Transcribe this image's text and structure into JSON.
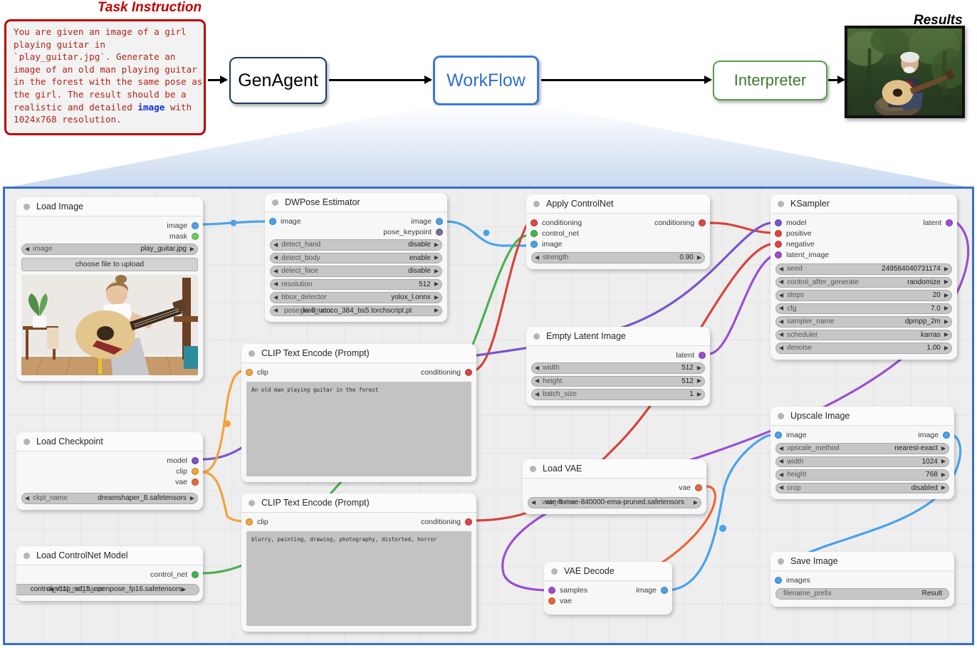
{
  "header": {
    "task_title": "Task Instruction",
    "results_title": "Results",
    "task_text_line1": "You are given an image of a girl playing guitar in `play_guitar.jpg`. Generate an image of an old man playing guitar in the forest with the same pose as the girl. The result should be a realistic and detailed ",
    "task_keyword": "image",
    "task_text_line2": " with 1024x768 resolution."
  },
  "pipeline": {
    "genagent": "GenAgent",
    "workflow": "WorkFlow",
    "interpreter": "Interpreter"
  },
  "nodes": [
    {
      "id": "load-image",
      "title": "Load Image",
      "inputs": [],
      "outputs": [
        {
          "name": "image",
          "color": "#4aa3e8"
        },
        {
          "name": "mask",
          "color": "#6dce5e"
        }
      ],
      "widgets": [
        {
          "label": "image",
          "value": "play_guitar.jpg",
          "arrows": true
        }
      ],
      "button": "choose file to upload",
      "preview": "girl-guitar"
    },
    {
      "id": "dwpose-estimator",
      "title": "DWPose Estimator",
      "inputs": [
        {
          "name": "image",
          "color": "#4aa3e8"
        }
      ],
      "outputs": [
        {
          "name": "image",
          "color": "#4aa3e8"
        },
        {
          "name": "pose_keypoint",
          "color": "#7a6f96"
        }
      ],
      "widgets": [
        {
          "label": "detect_hand",
          "value": "disable",
          "arrows": true
        },
        {
          "label": "detect_body",
          "value": "enable",
          "arrows": true
        },
        {
          "label": "detect_face",
          "value": "disable",
          "arrows": true
        },
        {
          "label": "resolution",
          "value": "512",
          "arrows": true
        },
        {
          "label": "bbox_detector",
          "value": "yolox_l.onnx",
          "arrows": true
        },
        {
          "label": "pose_estimator",
          "value": "dw-ll_ucoco_384_bs5.torchscript.pt",
          "arrows": true,
          "overlap": true
        }
      ]
    },
    {
      "id": "apply-controlnet",
      "title": "Apply ControlNet",
      "inputs": [
        {
          "name": "conditioning",
          "color": "#e04444"
        },
        {
          "name": "control_net",
          "color": "#44b44a"
        },
        {
          "name": "image",
          "color": "#4aa3e8"
        }
      ],
      "outputs": [
        {
          "name": "conditioning",
          "color": "#e04444"
        }
      ],
      "widgets": [
        {
          "label": "strength",
          "value": "0.90",
          "arrows": true
        }
      ]
    },
    {
      "id": "ksampler",
      "title": "KSampler",
      "inputs": [
        {
          "name": "model",
          "color": "#7a55c9"
        },
        {
          "name": "positive",
          "color": "#e04444"
        },
        {
          "name": "negative",
          "color": "#e04444"
        },
        {
          "name": "latent_image",
          "color": "#9b4fd0"
        }
      ],
      "outputs": [
        {
          "name": "latent",
          "color": "#9b4fd0"
        }
      ],
      "widgets": [
        {
          "label": "seed",
          "value": "249584040731174",
          "arrows": true
        },
        {
          "label": "control_after_generate",
          "value": "randomize",
          "arrows": true
        },
        {
          "label": "steps",
          "value": "20",
          "arrows": true
        },
        {
          "label": "cfg",
          "value": "7.0",
          "arrows": true
        },
        {
          "label": "sampler_name",
          "value": "dpmpp_2m",
          "arrows": true
        },
        {
          "label": "scheduler",
          "value": "karras",
          "arrows": true
        },
        {
          "label": "denoise",
          "value": "1.00",
          "arrows": true
        }
      ]
    },
    {
      "id": "clip-text-encode-positive",
      "title": "CLIP Text Encode (Prompt)",
      "inputs": [
        {
          "name": "clip",
          "color": "#f2a33c"
        }
      ],
      "outputs": [
        {
          "name": "conditioning",
          "color": "#e04444"
        }
      ],
      "widgets": [],
      "textarea": "An old man playing guitar in the forest"
    },
    {
      "id": "empty-latent-image",
      "title": "Empty Latent Image",
      "inputs": [],
      "outputs": [
        {
          "name": "latent",
          "color": "#9b4fd0"
        }
      ],
      "widgets": [
        {
          "label": "width",
          "value": "512",
          "arrows": true
        },
        {
          "label": "height",
          "value": "512",
          "arrows": true
        },
        {
          "label": "batch_size",
          "value": "1",
          "arrows": true
        }
      ]
    },
    {
      "id": "load-checkpoint",
      "title": "Load Checkpoint",
      "inputs": [],
      "outputs": [
        {
          "name": "model",
          "color": "#7a55c9"
        },
        {
          "name": "clip",
          "color": "#f2a33c"
        },
        {
          "name": "vae",
          "color": "#e8683a"
        }
      ],
      "widgets": [
        {
          "label": "ckpt_name",
          "value": "dreamshaper_8.safetensors",
          "arrows": true
        }
      ]
    },
    {
      "id": "upscale-image",
      "title": "Upscale Image",
      "inputs": [
        {
          "name": "image",
          "color": "#4aa3e8"
        }
      ],
      "outputs": [
        {
          "name": "image",
          "color": "#4aa3e8"
        }
      ],
      "widgets": [
        {
          "label": "upscale_method",
          "value": "nearest-exact",
          "arrows": true
        },
        {
          "label": "width",
          "value": "1024",
          "arrows": true
        },
        {
          "label": "height",
          "value": "768",
          "arrows": true
        },
        {
          "label": "crop",
          "value": "disabled",
          "arrows": true
        }
      ]
    },
    {
      "id": "load-vae",
      "title": "Load VAE",
      "inputs": [],
      "outputs": [
        {
          "name": "vae",
          "color": "#e8683a"
        }
      ],
      "widgets": [
        {
          "label": "vae_name",
          "value": "vae-ft-mse-840000-ema-pruned.safetensors",
          "arrows": true,
          "overlap": true
        }
      ]
    },
    {
      "id": "clip-text-encode-negative",
      "title": "CLIP Text Encode (Prompt)",
      "inputs": [
        {
          "name": "clip",
          "color": "#f2a33c"
        }
      ],
      "outputs": [
        {
          "name": "conditioning",
          "color": "#e04444"
        }
      ],
      "widgets": [],
      "textarea": "blurry, painting, drawing, photography, distorted, horror"
    },
    {
      "id": "load-controlnet-model",
      "title": "Load ControlNet Model",
      "inputs": [],
      "outputs": [
        {
          "name": "control_net",
          "color": "#44b44a"
        }
      ],
      "widgets": [
        {
          "label": "control_net_name",
          "value": "control_v11p_sd15_openpose_fp16.safetensors",
          "arrows": true,
          "overlap": true
        }
      ]
    },
    {
      "id": "vae-decode",
      "title": "VAE Decode",
      "inputs": [
        {
          "name": "samples",
          "color": "#9b4fd0"
        },
        {
          "name": "vae",
          "color": "#e8683a"
        }
      ],
      "outputs": [
        {
          "name": "image",
          "color": "#4aa3e8"
        }
      ],
      "widgets": []
    },
    {
      "id": "save-image",
      "title": "Save Image",
      "inputs": [
        {
          "name": "images",
          "color": "#4aa3e8"
        }
      ],
      "outputs": [],
      "widgets": [
        {
          "label": "filename_prefix",
          "value": "Result",
          "arrows": false,
          "plain": true
        }
      ]
    }
  ],
  "colors": {
    "canvas_border": "#3a6fc4",
    "task_border": "#c00000",
    "workflow_border": "#3a7ad9",
    "interpreter_border": "#5a9e4b",
    "genagent_border": "#1f3864"
  }
}
